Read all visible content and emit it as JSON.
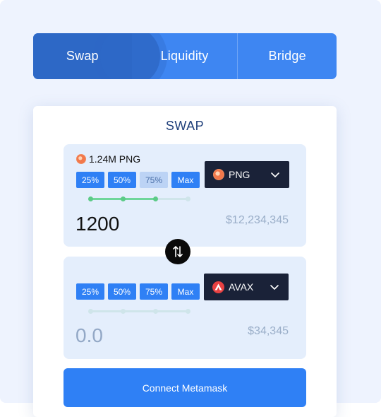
{
  "tabs": [
    {
      "label": "Swap"
    },
    {
      "label": "Liquidity"
    },
    {
      "label": "Bridge"
    }
  ],
  "card": {
    "title": "SWAP"
  },
  "from": {
    "balance": "1.24M PNG",
    "percent_buttons": [
      "25%",
      "50%",
      "75%",
      "Max"
    ],
    "selected_percent": "75%",
    "slider_value": 0.67,
    "token": "PNG",
    "token_icon": "png-token-icon",
    "amount": "1200",
    "usd_value": "$12,234,345"
  },
  "to": {
    "percent_buttons": [
      "25%",
      "50%",
      "75%",
      "Max"
    ],
    "slider_value": 0,
    "token": "AVAX",
    "token_icon": "avax-token-icon",
    "amount": "0.0",
    "usd_value": "$34,345"
  },
  "connect_button": {
    "label": "Connect Metamask"
  },
  "colors": {
    "accent": "#2f80f5",
    "tab_bar": "#3e86f2",
    "tab_active": "#2d68c6",
    "token_select_bg": "#1a2238",
    "slider_fill": "#6fd69a",
    "avax_red": "#e84142",
    "png_orange": "#f2784b"
  }
}
